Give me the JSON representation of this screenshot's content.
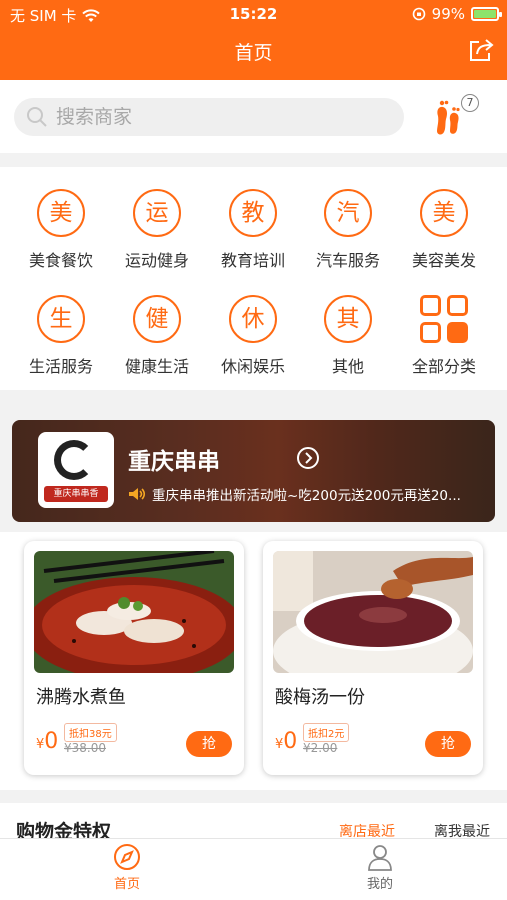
{
  "status_bar": {
    "carrier": "无 SIM 卡",
    "time": "15:22",
    "battery": "99%"
  },
  "header": {
    "title": "首页"
  },
  "search": {
    "placeholder": "搜索商家",
    "footprint_count": "7"
  },
  "categories": [
    {
      "glyph": "美",
      "label": "美食餐饮"
    },
    {
      "glyph": "运",
      "label": "运动健身"
    },
    {
      "glyph": "教",
      "label": "教育培训"
    },
    {
      "glyph": "汽",
      "label": "汽车服务"
    },
    {
      "glyph": "美",
      "label": "美容美发"
    },
    {
      "glyph": "生",
      "label": "生活服务"
    },
    {
      "glyph": "健",
      "label": "健康生活"
    },
    {
      "glyph": "休",
      "label": "休闲娱乐"
    },
    {
      "glyph": "其",
      "label": "其他"
    },
    {
      "glyph": "",
      "label": "全部分类"
    }
  ],
  "shop": {
    "name": "重庆串串",
    "logo_text": "重庆串串香",
    "notice": "重庆串串推出新活动啦~吃200元送200元再送20..."
  },
  "deals": [
    {
      "title": "沸腾水煮鱼",
      "price": "0",
      "currency": "¥",
      "discount": "抵扣38元",
      "original": "¥38.00",
      "button": "抢"
    },
    {
      "title": "酸梅汤一份",
      "price": "0",
      "currency": "¥",
      "discount": "抵扣2元",
      "original": "¥2.00",
      "button": "抢"
    }
  ],
  "section": {
    "title": "购物金特权",
    "tab_near_shop": "离店最近",
    "tab_near_me": "离我最近"
  },
  "tabbar": [
    {
      "label": "首页"
    },
    {
      "label": "我的"
    }
  ],
  "colors": {
    "accent": "#ff6a13",
    "background": "#f2f2f2"
  }
}
